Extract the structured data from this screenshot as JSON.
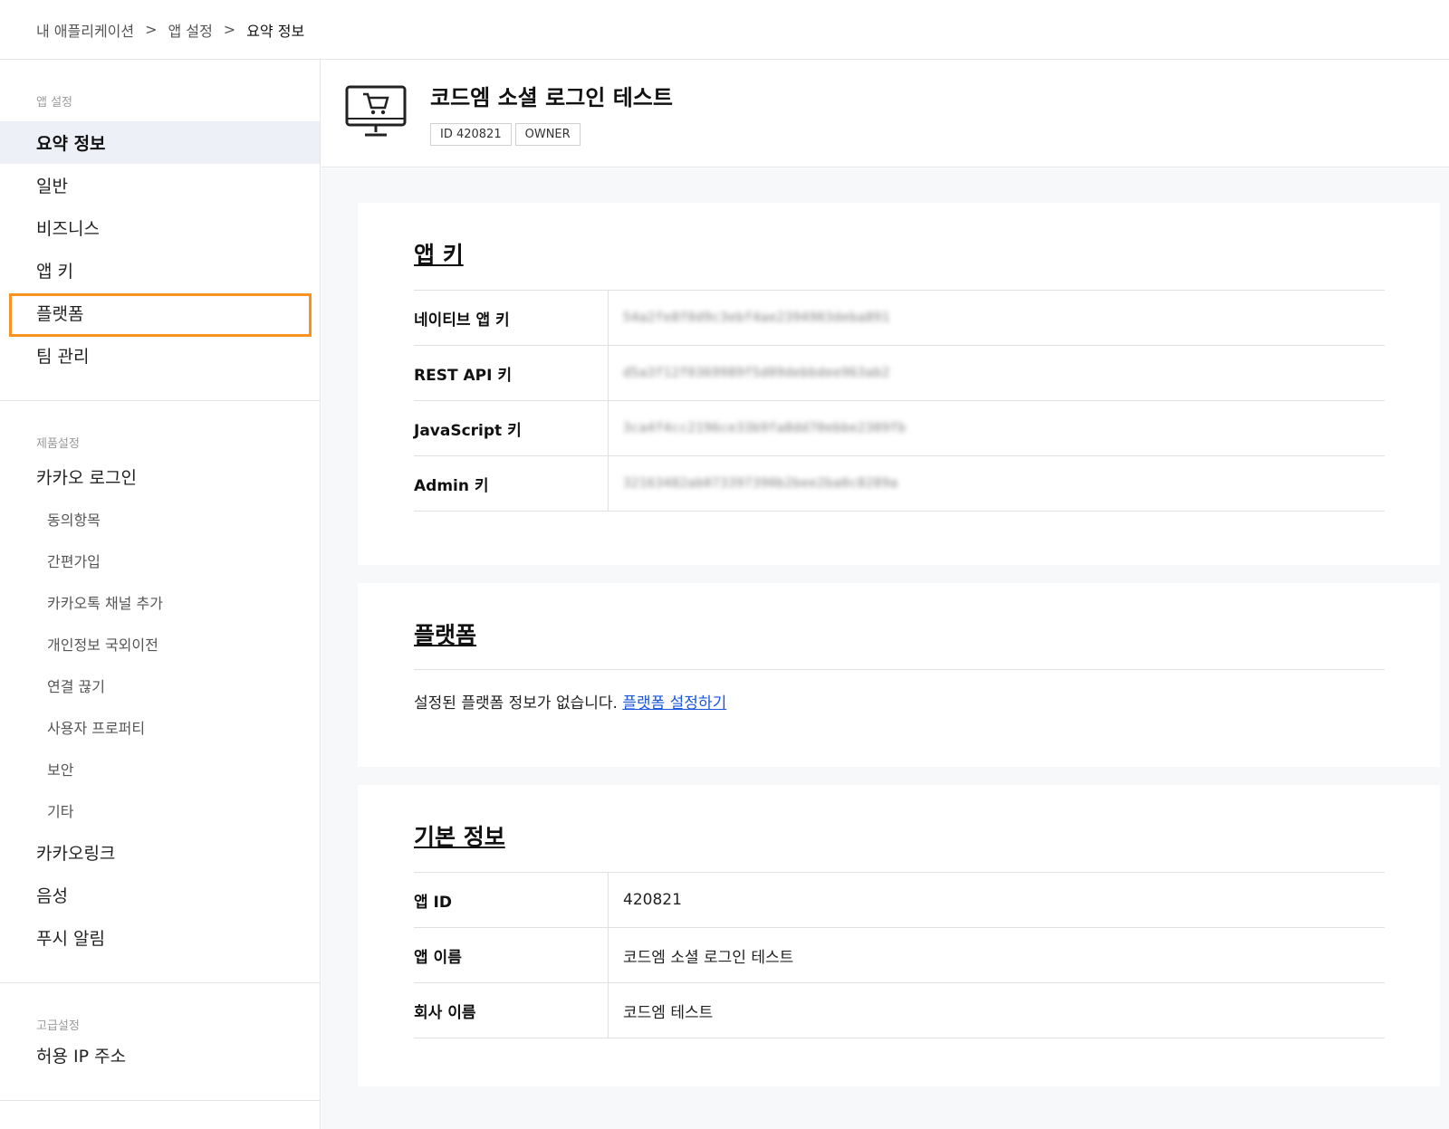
{
  "breadcrumb": {
    "items": [
      "내 애플리케이션",
      "앱 설정",
      "요약 정보"
    ],
    "separator": ">"
  },
  "sidebar": {
    "groups": [
      {
        "heading": "앱 설정",
        "items": [
          "요약 정보",
          "일반",
          "비즈니스",
          "앱 키",
          "플랫폼",
          "팀 관리"
        ]
      },
      {
        "heading": "제품설정",
        "kakao_login": "카카오 로그인",
        "sub_items": [
          "동의항목",
          "간편가입",
          "카카오톡 채널 추가",
          "개인정보 국외이전",
          "연결 끊기",
          "사용자 프로퍼티",
          "보안",
          "기타"
        ],
        "items_after": [
          "카카오링크",
          "음성",
          "푸시 알림"
        ]
      },
      {
        "heading": "고급설정",
        "items": [
          "허용 IP 주소"
        ]
      }
    ],
    "active_item": "요약 정보",
    "highlighted_item": "플랫폼"
  },
  "app": {
    "title": "코드엠 소셜 로그인 테스트",
    "badges": [
      "ID 420821",
      "OWNER"
    ],
    "icon": "shopping-cart-monitor-icon"
  },
  "app_keys": {
    "title": "앱 키",
    "rows": [
      {
        "label": "네이티브 앱 키",
        "value": "54a2fe8f0d9c3ebf4ae2394903deba891"
      },
      {
        "label": "REST API 키",
        "value": "d5a3f12f0369989f5d09debbdee963ab2"
      },
      {
        "label": "JavaScript 키",
        "value": "3ca4f4cc2196ce33b9fa8dd70ebbe2309fb"
      },
      {
        "label": "Admin 키",
        "value": "32163482ab073397390b2bee2ba0c8289a"
      }
    ]
  },
  "platform": {
    "title": "플랫폼",
    "message": "설정된 플랫폼 정보가 없습니다.",
    "link": "플랫폼 설정하기"
  },
  "basic_info": {
    "title": "기본 정보",
    "rows": [
      {
        "label": "앱 ID",
        "value": "420821"
      },
      {
        "label": "앱 이름",
        "value": "코드엠 소셜 로그인 테스트"
      },
      {
        "label": "회사 이름",
        "value": "코드엠 테스트"
      }
    ]
  },
  "colors": {
    "highlight": "#f7931e",
    "active_bg": "#eef0f7",
    "link": "#1a56db"
  }
}
